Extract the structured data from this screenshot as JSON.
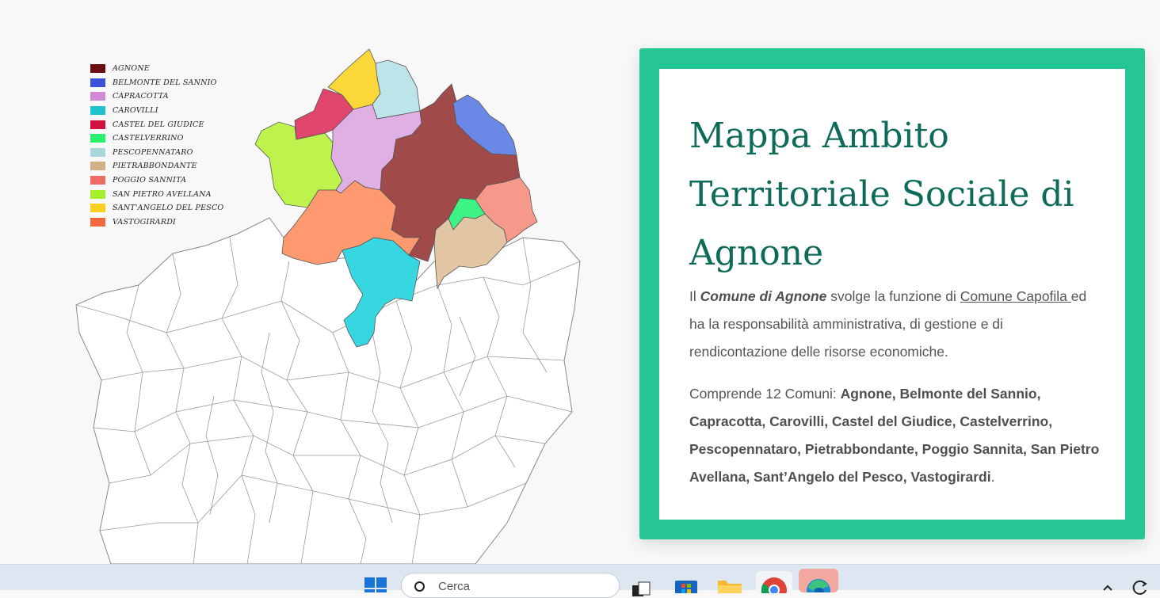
{
  "map": {
    "legend": [
      {
        "label": "AGNONE",
        "color": "#6b0e12"
      },
      {
        "label": "BELMONTE DEL SANNIO",
        "color": "#3b50d8"
      },
      {
        "label": "CAPRACOTTA",
        "color": "#d08ad6"
      },
      {
        "label": "CAROVILLI",
        "color": "#1fc2cd"
      },
      {
        "label": "CASTEL DEL GIUDICE",
        "color": "#d1123f"
      },
      {
        "label": "CASTELVERRINO",
        "color": "#2af06f"
      },
      {
        "label": "PESCOPENNATARO",
        "color": "#a8d7dd"
      },
      {
        "label": "PIETRABBONDANTE",
        "color": "#d3b086"
      },
      {
        "label": "POGGIO SANNITA",
        "color": "#ee6c64"
      },
      {
        "label": "SAN PIETRO AVELLANA",
        "color": "#a6ef2d"
      },
      {
        "label": "SANT'ANGELO DEL PESCO",
        "color": "#fad020"
      },
      {
        "label": "VASTOGIRARDI",
        "color": "#f1683e"
      }
    ]
  },
  "card": {
    "title": "Mappa Ambito Territoriale Sociale di Agnone",
    "p1_prefix": "Il ",
    "p1_bold": "Comune di Agnone",
    "p1_mid": " svolge la funzione di ",
    "p1_link": "Comune Capofila ",
    "p1_suffix": "ed ha la responsabilità amministrativa, di gestione e di rendicontazione delle risorse economiche.",
    "p2_prefix": "Comprende 12 Comuni: ",
    "p2_bold": "Agnone, Belmonte del Sannio, Capracotta, Carovilli, Castel del Giudice, Castelverrino, Pescopennataro, Pietrabbondante, Poggio Sannita, San Pietro Avellana, Sant’Angelo del Pesco, Vastogirardi",
    "p2_suffix": ".",
    "bg_color": "#26c596",
    "title_color": "#0f6b59"
  },
  "taskbar": {
    "search_placeholder": "Cerca",
    "icons": [
      "windows-start-icon",
      "search-icon",
      "task-view-icon",
      "microsoft-store-icon",
      "file-explorer-icon",
      "chrome-icon",
      "edge-icon",
      "chevron-up-icon",
      "refresh-icon"
    ]
  }
}
